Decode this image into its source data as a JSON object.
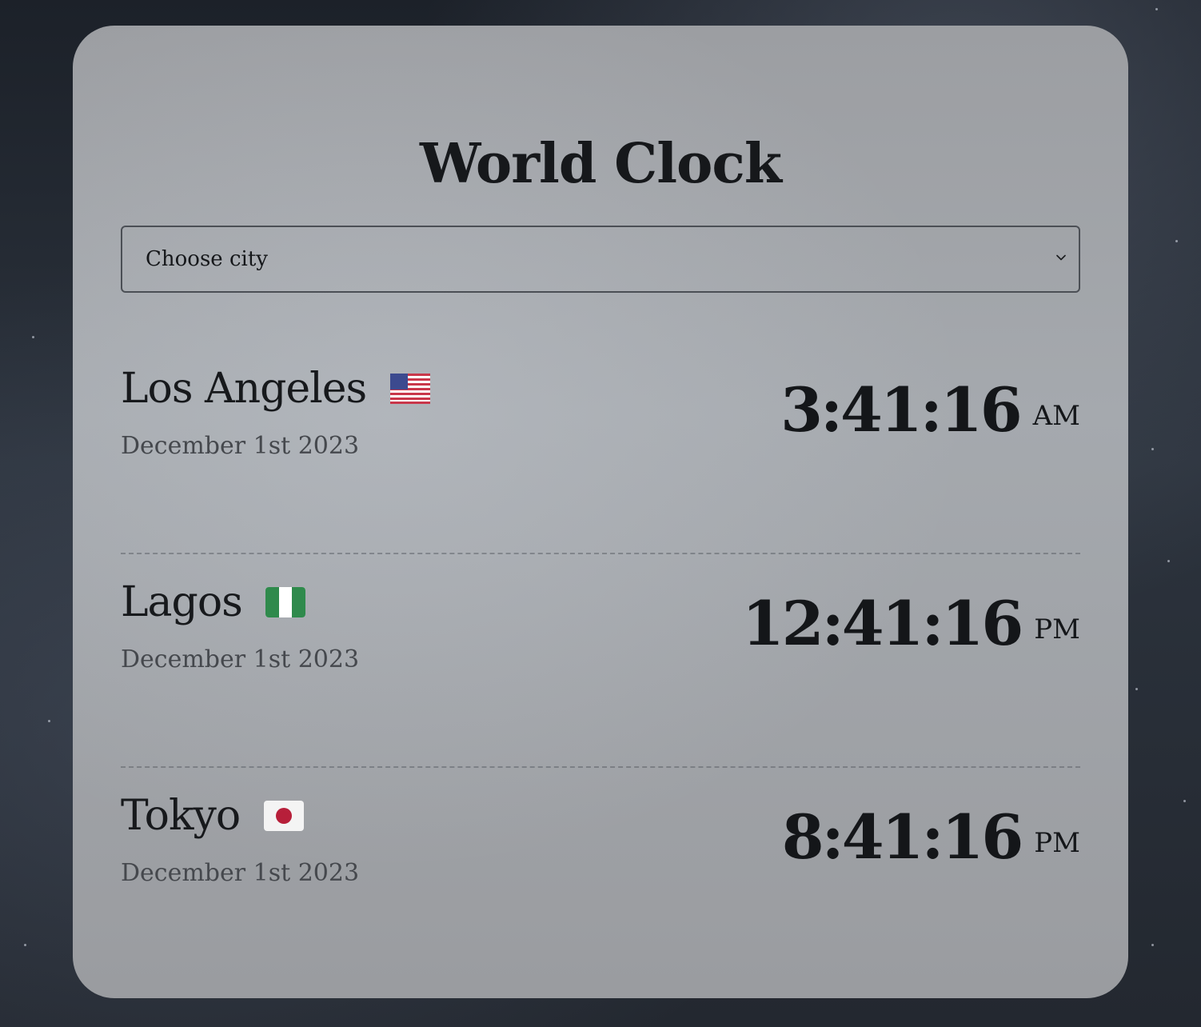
{
  "app": {
    "title": "World Clock"
  },
  "city_select": {
    "placeholder": "Choose city",
    "icon": "chevron-down-icon"
  },
  "cities": [
    {
      "name": "Los Angeles",
      "flag": "us-flag-icon",
      "date": "December 1st 2023",
      "time": "3:41:16",
      "ampm": "AM"
    },
    {
      "name": "Lagos",
      "flag": "nigeria-flag-icon",
      "date": "December 1st 2023",
      "time": "12:41:16",
      "ampm": "PM"
    },
    {
      "name": "Tokyo",
      "flag": "japan-flag-icon",
      "date": "December 1st 2023",
      "time": "8:41:16",
      "ampm": "PM"
    }
  ],
  "colors": {
    "card_background": "#a1a4a8",
    "text_primary": "#16181b",
    "text_secondary": "#45484d",
    "page_background": "#262b33"
  }
}
